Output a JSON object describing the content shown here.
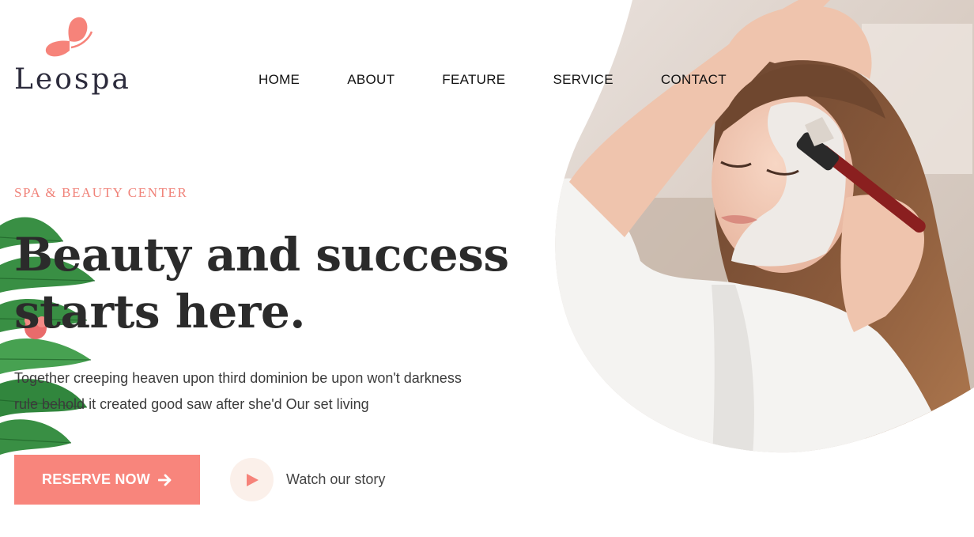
{
  "brand": {
    "name": "Leospa",
    "accent_color": "#f8857c",
    "text_color": "#2c2b3c"
  },
  "nav": {
    "items": [
      {
        "label": "HOME"
      },
      {
        "label": "ABOUT"
      },
      {
        "label": "FEATURE"
      },
      {
        "label": "SERVICE"
      },
      {
        "label": "CONTACT"
      }
    ]
  },
  "hero": {
    "eyebrow": "SPA & BEAUTY CENTER",
    "headline_line1": "Beauty and success",
    "headline_line2": "starts here.",
    "description_line1": "Together creeping heaven upon third dominion be upon won't darkness",
    "description_line2": "rule behold it created good saw after she'd Our set living",
    "reserve_label": "RESERVE NOW",
    "reserve_icon": "arrow-right-icon",
    "watch_label": "Watch our story",
    "watch_icon": "play-icon",
    "image_subject": "woman-facial-mask-photo"
  }
}
